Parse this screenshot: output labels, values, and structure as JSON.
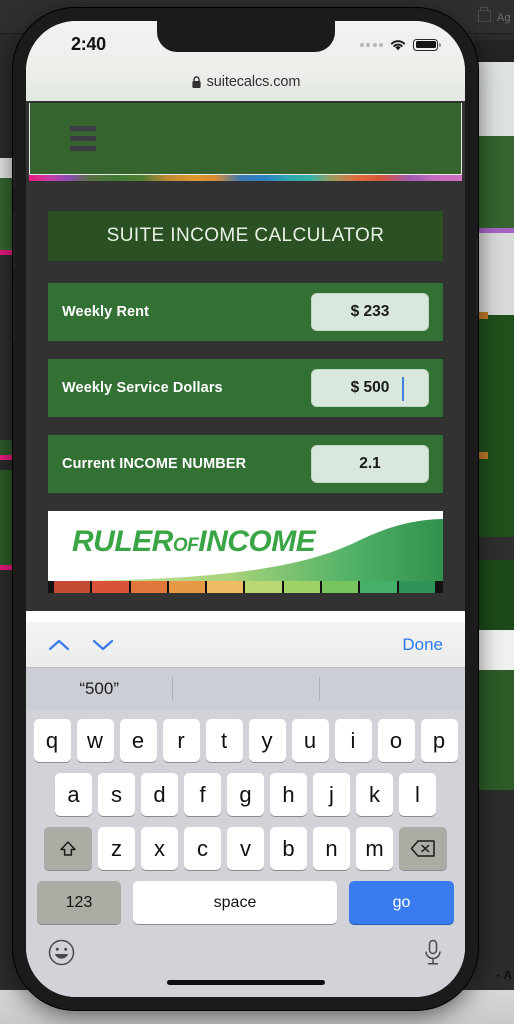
{
  "background": {
    "topbar_label": "Ag",
    "bottom_label": "- A"
  },
  "phone": {
    "statusbar": {
      "time": "2:40",
      "signal_icon": "signal-dots-icon",
      "wifi_icon": "wifi-icon",
      "battery_icon": "battery-icon"
    },
    "browser": {
      "lock_icon": "lock-icon",
      "url": "suitecalcs.com"
    }
  },
  "site": {
    "menu_icon": "hamburger-menu-icon",
    "title": "SUITE INCOME CALCULATOR",
    "rows": [
      {
        "label": "Weekly Rent",
        "value": "$ 233",
        "focused": false
      },
      {
        "label": "Weekly Service Dollars",
        "value": "$ 500",
        "focused": true
      },
      {
        "label": "Current INCOME NUMBER",
        "value": "2.1",
        "focused": false
      }
    ],
    "banner": {
      "word1": "RULER",
      "word2": "OF",
      "word3": "INCOME"
    }
  },
  "keyboard": {
    "toolbar": {
      "prev_icon": "chevron-up-icon",
      "next_icon": "chevron-down-icon",
      "done_label": "Done"
    },
    "suggestions": [
      "“500”",
      "",
      ""
    ],
    "row1": [
      "q",
      "w",
      "e",
      "r",
      "t",
      "y",
      "u",
      "i",
      "o",
      "p"
    ],
    "row2": [
      "a",
      "s",
      "d",
      "f",
      "g",
      "h",
      "j",
      "k",
      "l"
    ],
    "row3": [
      "z",
      "x",
      "c",
      "v",
      "b",
      "n",
      "m"
    ],
    "shift_icon": "shift-arrow-icon",
    "backspace_icon": "backspace-icon",
    "numbers_label": "123",
    "space_label": "space",
    "go_label": "go",
    "emoji_icon": "emoji-smiley-icon",
    "mic_icon": "microphone-icon"
  },
  "colors": {
    "header_green": "#35642f",
    "row_green": "#337034",
    "title_green": "#2a5024",
    "input_mint": "#d9e8dc",
    "page_dark": "#323232",
    "accent_blue": "#2a7bf0",
    "ruler_green": "#3aa545"
  }
}
